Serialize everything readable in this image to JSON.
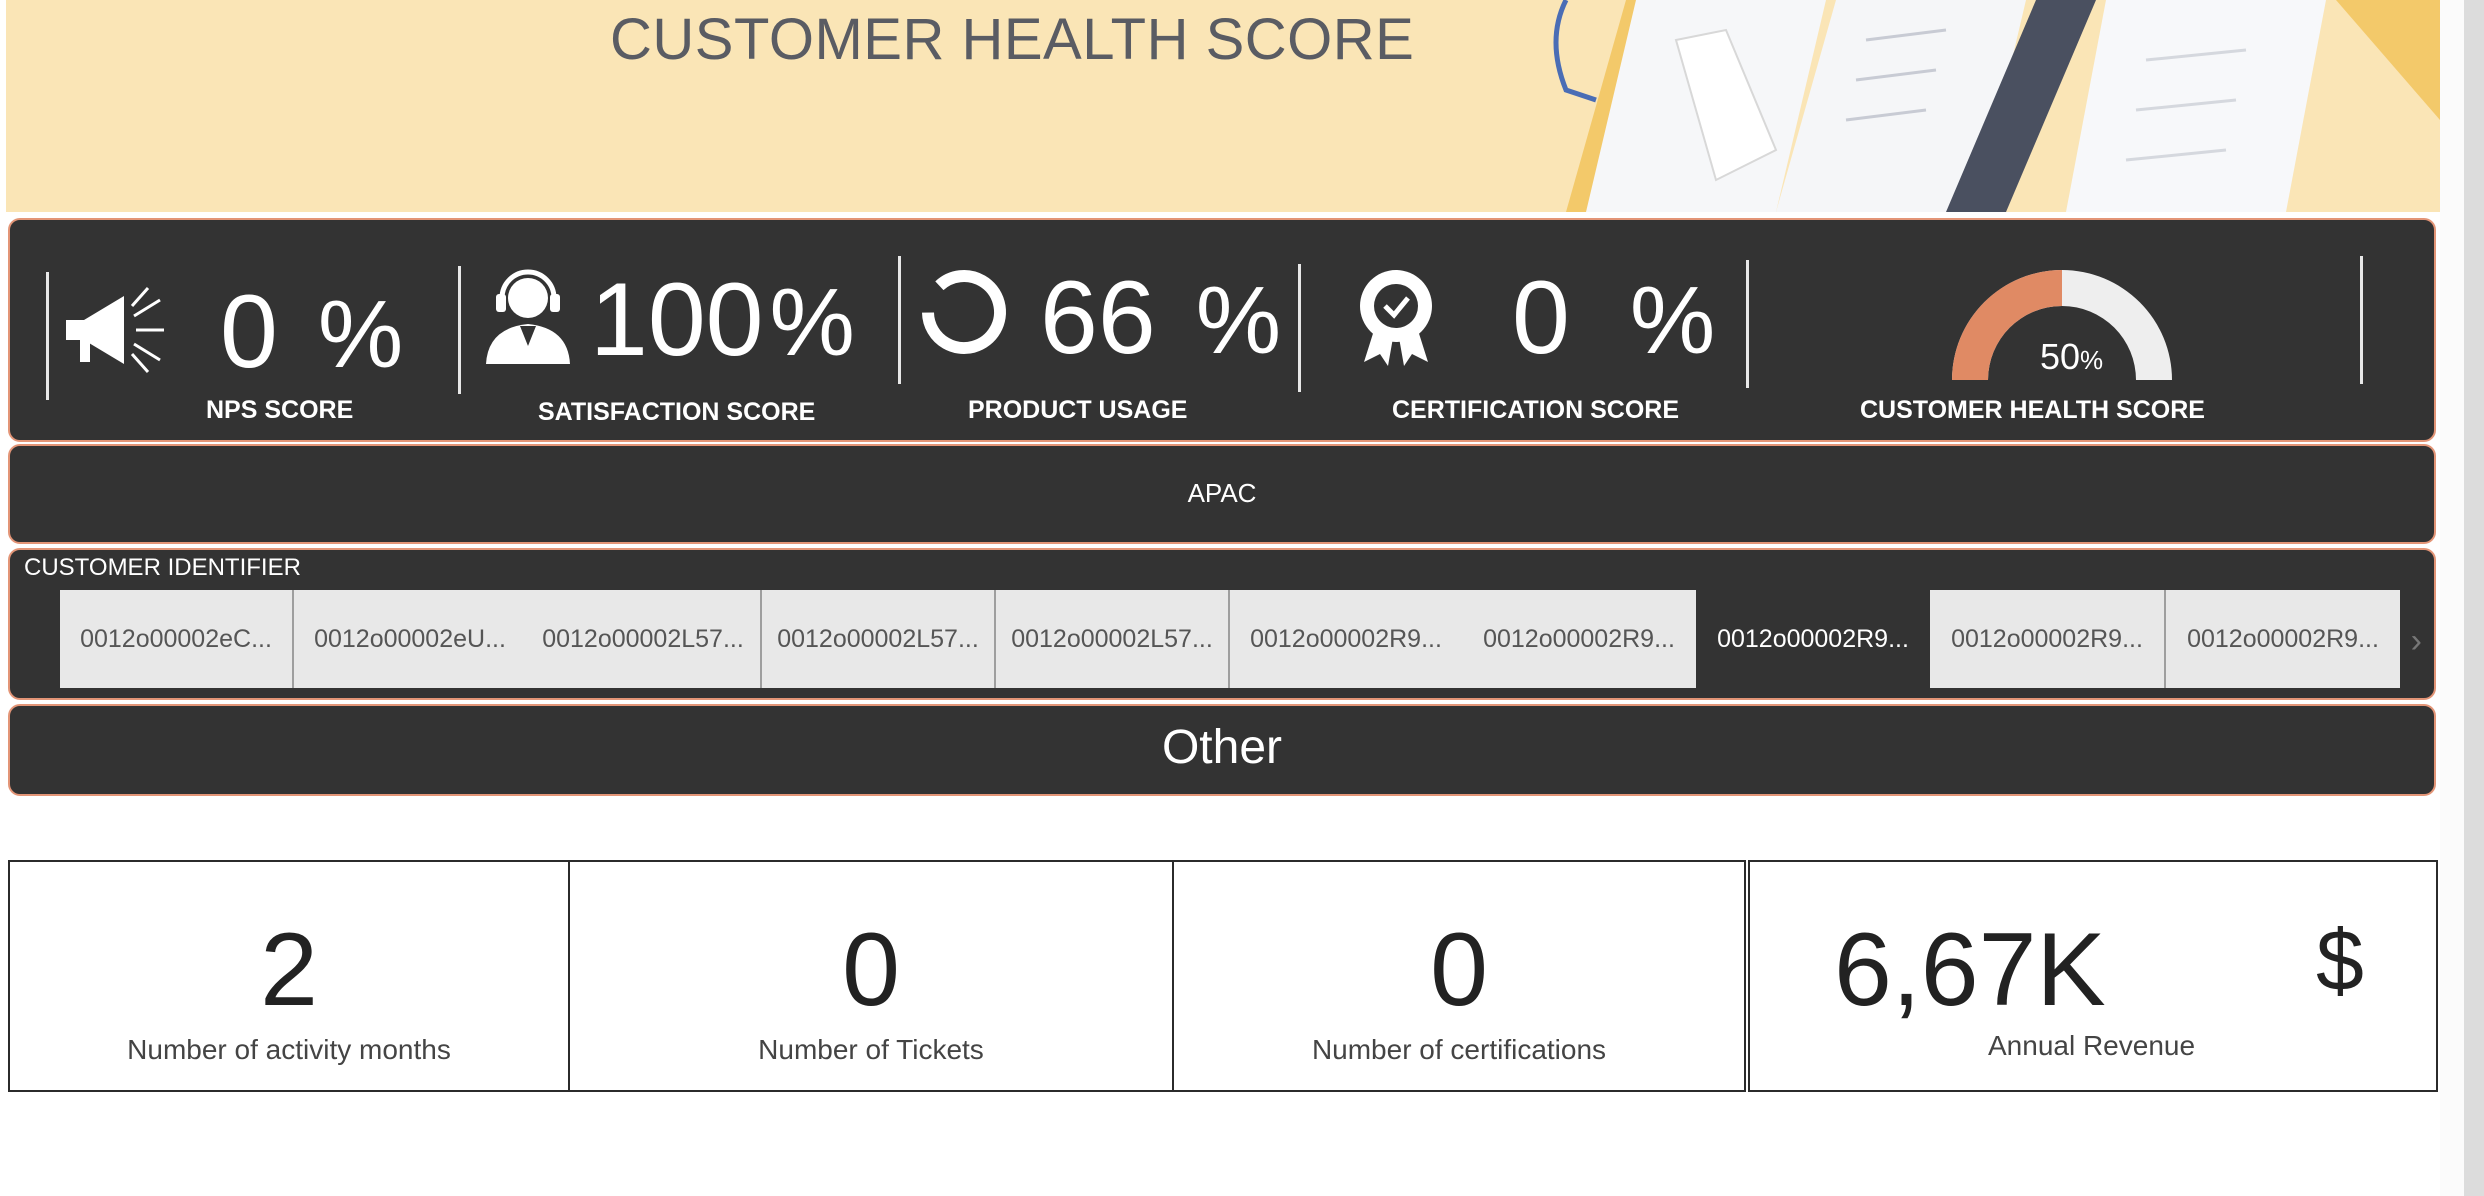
{
  "header": {
    "title": "CUSTOMER HEALTH SCORE"
  },
  "kpis": [
    {
      "label": "NPS SCORE",
      "value": "0",
      "unit": "%",
      "icon": "megaphone-icon"
    },
    {
      "label": "SATISFACTION SCORE",
      "value": "100",
      "unit": "%",
      "icon": "support-agent-icon"
    },
    {
      "label": "PRODUCT USAGE",
      "value": "66",
      "unit": "%",
      "icon": "ring-progress-icon"
    },
    {
      "label": "CERTIFICATION SCORE",
      "value": "0",
      "unit": "%",
      "icon": "certificate-badge-icon"
    }
  ],
  "health_gauge": {
    "label": "CUSTOMER HEALTH SCORE",
    "value": "50",
    "unit": "%",
    "fraction": 0.5,
    "fill_color": "#e08a64",
    "track_color": "#eeeeee"
  },
  "region": {
    "value": "APAC"
  },
  "identifier": {
    "title": "CUSTOMER IDENTIFIER",
    "items": [
      "0012o00002eC...",
      "0012o00002eU...",
      "0012o00002L57...",
      "0012o00002L57...",
      "0012o00002L57...",
      "0012o00002R9...",
      "0012o00002R9...",
      "0012o00002R9...",
      "0012o00002R9...",
      "0012o00002R9..."
    ],
    "selected_index": 7
  },
  "segment": {
    "value": "Other"
  },
  "cards": [
    {
      "value": "2",
      "label": "Number of activity months"
    },
    {
      "value": "0",
      "label": "Number of Tickets"
    },
    {
      "value": "0",
      "label": "Number of certifications"
    },
    {
      "value": "6,67K",
      "unit": "$",
      "label": "Annual Revenue"
    }
  ],
  "colors": {
    "banner": "#fae5b6",
    "panel": "#333333",
    "panel_border": "#e39577",
    "gauge_fill": "#e08a64"
  }
}
